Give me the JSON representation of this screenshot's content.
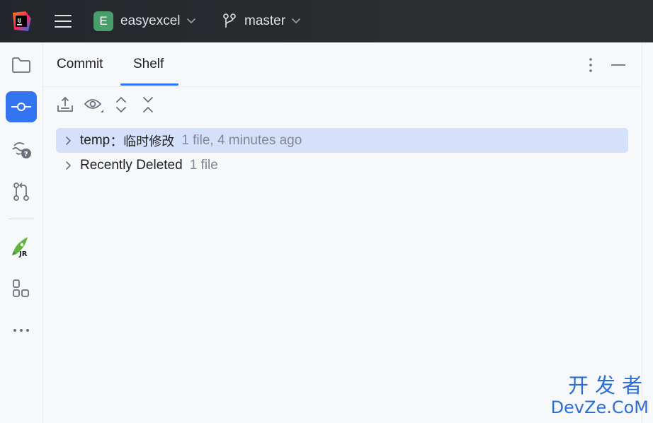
{
  "titlebar": {
    "project_badge": "E",
    "project_name": "easyexcel",
    "branch_name": "master"
  },
  "stripe": {
    "items": [
      {
        "name": "project",
        "icon": "folder-icon",
        "active": false
      },
      {
        "name": "commit",
        "icon": "commit-icon",
        "active": true
      },
      {
        "name": "problems",
        "icon": "problems-icon",
        "active": false
      },
      {
        "name": "pull-requests",
        "icon": "pull-request-icon",
        "active": false
      },
      {
        "name": "jrebel",
        "icon": "jrebel-rocket-icon",
        "active": false
      },
      {
        "name": "structure",
        "icon": "structure-icon",
        "active": false
      },
      {
        "name": "more",
        "icon": "more-horizontal-icon",
        "active": false
      }
    ]
  },
  "tabs": {
    "commit": "Commit",
    "shelf": "Shelf",
    "active": "Shelf"
  },
  "toolbar": {
    "buttons": [
      "unshelve-icon",
      "preview-icon",
      "expand-all-icon",
      "collapse-all-icon"
    ]
  },
  "tree": [
    {
      "label": "temp",
      "separator": "：",
      "description": "临时修改",
      "meta": "1 file, 4 minutes ago",
      "selected": true
    },
    {
      "label": "Recently Deleted",
      "meta": "1 file",
      "selected": false
    }
  ],
  "watermark": {
    "cn": "开发者",
    "en": "DevZe.CoM"
  },
  "colors": {
    "accent": "#3574f0",
    "selection": "#d5e1fb",
    "titlebar": "#2b2d30",
    "muted_text": "#818594",
    "watermark": "#2b6fd6"
  }
}
